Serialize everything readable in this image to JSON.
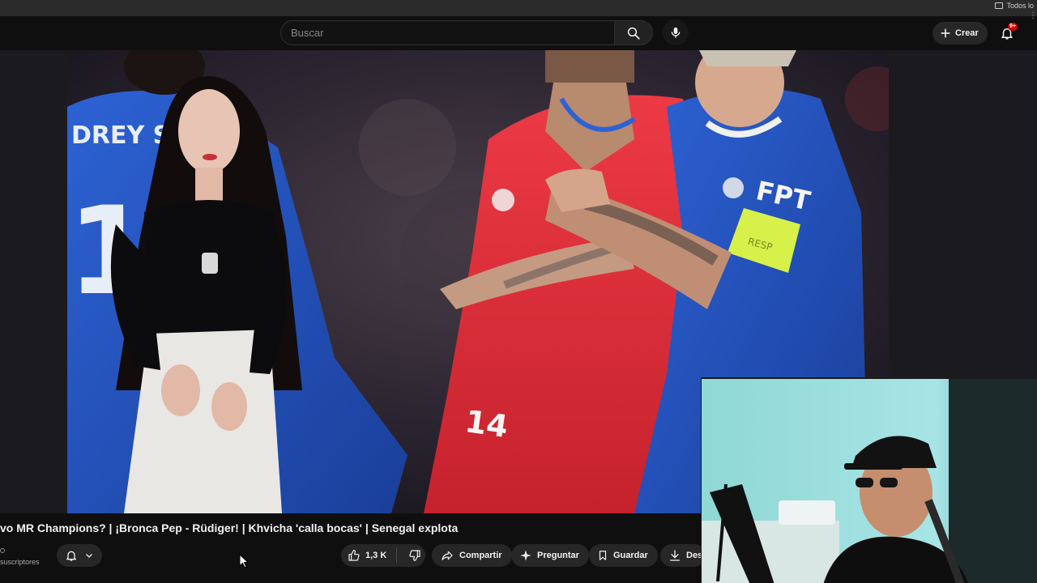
{
  "browser": {
    "bookmark_folder": "Todos lo"
  },
  "search": {
    "placeholder": "Buscar"
  },
  "header": {
    "create_label": "Crear",
    "notifications_badge": "9+"
  },
  "video": {
    "title": "vo MR Champions? | ¡Bronca Pep - Rüdiger! | Khvicha 'calla bocas' | Senegal explota",
    "subscribers_label": "suscriptores",
    "jersey_number_left": "17",
    "jersey_name_left": "DREY SAA",
    "jersey_number_center": "14",
    "sponsor_right": "FPT",
    "armband_text": "RESP"
  },
  "actions": {
    "likes": "1,3 K",
    "share": "Compartir",
    "ask": "Preguntar",
    "save": "Guardar",
    "download": "Des"
  },
  "colors": {
    "accent_red": "#cc0000",
    "chelsea_blue": "#1f4fb8",
    "atletico_red": "#e0303a",
    "armband_yellow": "#d8f04a"
  }
}
